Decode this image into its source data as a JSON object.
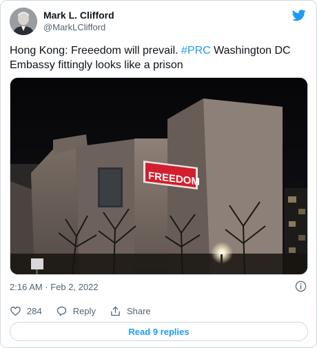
{
  "author": {
    "display_name": "Mark L. Clifford",
    "handle": "@MarkLClifford"
  },
  "tweet": {
    "text_before": "Hong Kong: Freeedom will prevail. ",
    "hashtag": "#PRC",
    "text_after": " Washington DC Embassy fittingly looks like a prison"
  },
  "media": {
    "projected_sign": "FREEDOM"
  },
  "meta": {
    "timestamp": "2:16 AM · Feb 2, 2022"
  },
  "actions": {
    "like_count": "284",
    "reply_label": "Reply",
    "share_label": "Share"
  },
  "read_replies_label": "Read 9 replies",
  "colors": {
    "accent": "#1d9bf0",
    "secondary_text": "#536471",
    "border": "#cfd9de",
    "sign_red": "#d11f2e"
  },
  "icons": [
    "twitter-bird-icon",
    "info-icon",
    "heart-icon",
    "reply-icon",
    "share-icon"
  ]
}
